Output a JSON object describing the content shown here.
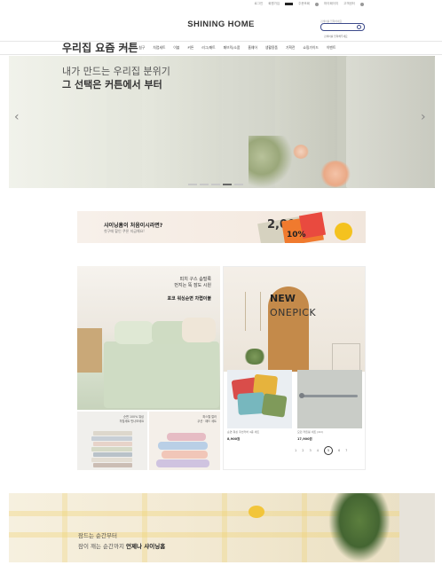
{
  "utility_bar": {
    "items": [
      "로그인",
      "회원가입",
      "주문조회",
      "마이페이지",
      "고객센터"
    ]
  },
  "header": {
    "logo": "SHINING HOME",
    "search": {
      "hint": "검색어를 입력하세요",
      "placeholder": "검색어를 입력해주세요"
    }
  },
  "nav": {
    "items": [
      "BEST",
      "NEW",
      "침구",
      "차렵세트",
      "이불",
      "커튼",
      "러그/매트",
      "패브릭/소품",
      "홈웨어",
      "생활용품",
      "기획전",
      "쇼핑가이드",
      "이벤트"
    ]
  },
  "hero": {
    "line1": "우리집 요즘 커튼",
    "line2": "내가 만드는 우리집 분위기",
    "line3": "그 선택은 커튼에서 부터",
    "prev": "‹",
    "next": "›",
    "slide_count": 5,
    "active_slide": 4
  },
  "promo": {
    "title": "샤이닝홈이 처음이시라면?",
    "subtitle": "첫구매 할인 쿠폰 지급해요!",
    "coupon_amount": "2,000",
    "coupon_percent": "10%"
  },
  "products": {
    "block1": {
      "line1": "피치 구스 솜털룩",
      "line2": "먼지는 뚝 잠도 시원",
      "line3": "포코 워싱순면 차렵이불"
    },
    "block2": {
      "line1": "순면 100% 워싱",
      "line2": "차렵세트 만나보세요"
    },
    "block3": {
      "line1": "파스텔 컬러",
      "line2": "쿠션 · 패드 세트"
    },
    "onepick": {
      "new": "NEW",
      "onepick": "ONEPICK",
      "item1": {
        "caption": "순면 워싱 쿠션커버 4종 세트",
        "price": "8,900원"
      },
      "item2": {
        "caption": "모던 커튼봉 세트 (2m)",
        "price": "17,900원"
      },
      "pages": [
        "1",
        "2",
        "3",
        "4",
        "5",
        "6",
        "7"
      ],
      "current_page": "5"
    }
  },
  "bottom_banner": {
    "line1": "잠드는 순간부터",
    "line2a": "잠이 깨는 순간까지 ",
    "line2b": "언제나 샤이닝홈"
  },
  "colors": {
    "accent": "#3c4a8a",
    "coupon_orange": "#f07a2e",
    "coupon_red": "#e94a3f",
    "sticker": "#f4c21f"
  }
}
